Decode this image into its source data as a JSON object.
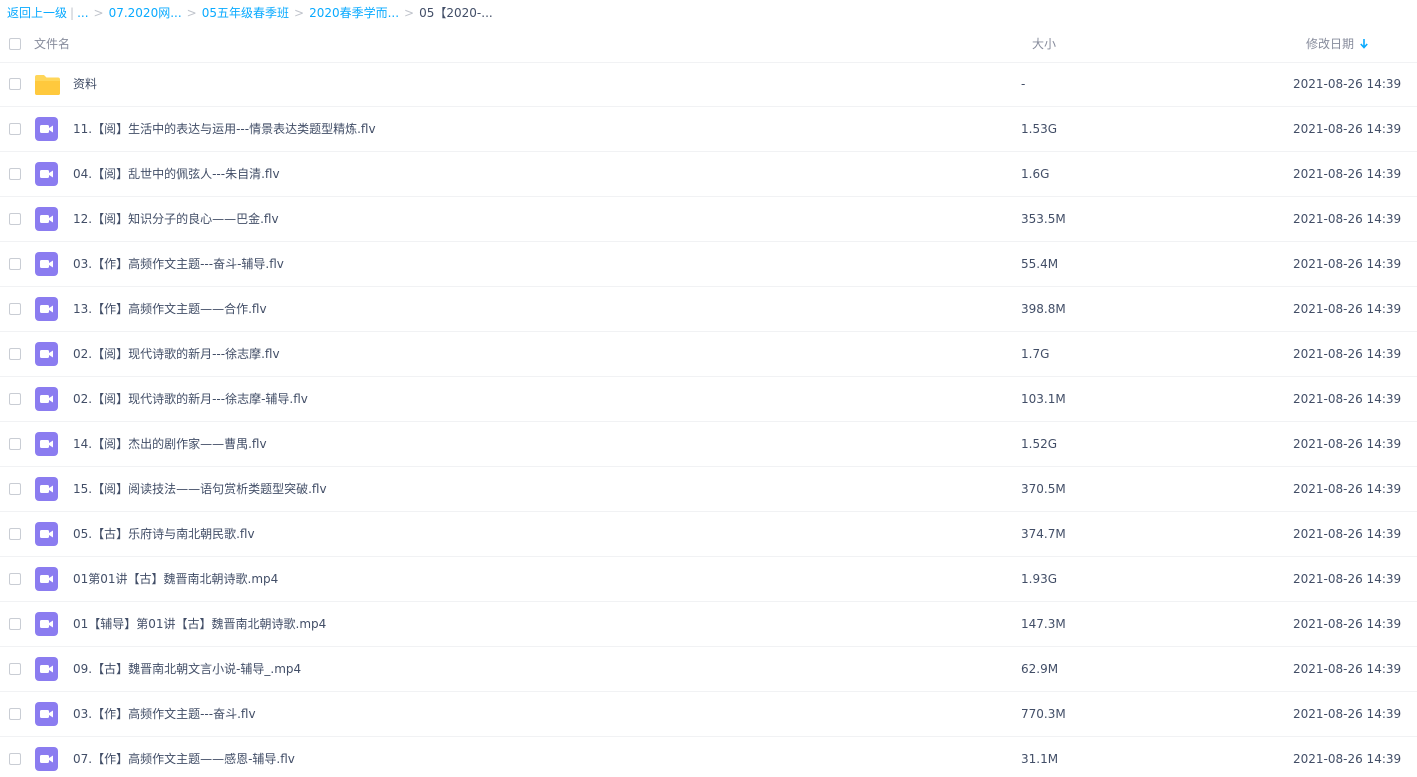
{
  "breadcrumb": {
    "back_label": "返回上一级",
    "ellipsis": "...",
    "items": [
      "07.2020网...",
      "05五年级春季班",
      "2020春季学而..."
    ],
    "current": "05【2020-..."
  },
  "header": {
    "name_label": "文件名",
    "size_label": "大小",
    "date_label": "修改日期",
    "sort_icon": "arrow-down-icon",
    "accent_color": "#09aaff"
  },
  "icons": {
    "folder": "folder-icon",
    "video": "video-file-icon",
    "folder_color": "#ffd659",
    "video_color": "#8b7cf0"
  },
  "files": [
    {
      "type": "folder",
      "name": "资料",
      "size": "-",
      "date": "2021-08-26 14:39"
    },
    {
      "type": "video",
      "name": "11.【阅】生活中的表达与运用---情景表达类题型精炼.flv",
      "size": "1.53G",
      "date": "2021-08-26 14:39"
    },
    {
      "type": "video",
      "name": "04.【阅】乱世中的佩弦人---朱自清.flv",
      "size": "1.6G",
      "date": "2021-08-26 14:39"
    },
    {
      "type": "video",
      "name": "12.【阅】知识分子的良心——巴金.flv",
      "size": "353.5M",
      "date": "2021-08-26 14:39"
    },
    {
      "type": "video",
      "name": "03.【作】高频作文主题---奋斗-辅导.flv",
      "size": "55.4M",
      "date": "2021-08-26 14:39"
    },
    {
      "type": "video",
      "name": "13.【作】高频作文主题——合作.flv",
      "size": "398.8M",
      "date": "2021-08-26 14:39"
    },
    {
      "type": "video",
      "name": "02.【阅】现代诗歌的新月---徐志摩.flv",
      "size": "1.7G",
      "date": "2021-08-26 14:39"
    },
    {
      "type": "video",
      "name": "02.【阅】现代诗歌的新月---徐志摩-辅导.flv",
      "size": "103.1M",
      "date": "2021-08-26 14:39"
    },
    {
      "type": "video",
      "name": "14.【阅】杰出的剧作家——曹禺.flv",
      "size": "1.52G",
      "date": "2021-08-26 14:39"
    },
    {
      "type": "video",
      "name": "15.【阅】阅读技法——语句赏析类题型突破.flv",
      "size": "370.5M",
      "date": "2021-08-26 14:39"
    },
    {
      "type": "video",
      "name": "05.【古】乐府诗与南北朝民歌.flv",
      "size": "374.7M",
      "date": "2021-08-26 14:39"
    },
    {
      "type": "video",
      "name": "01第01讲【古】魏晋南北朝诗歌.mp4",
      "size": "1.93G",
      "date": "2021-08-26 14:39"
    },
    {
      "type": "video",
      "name": "01【辅导】第01讲【古】魏晋南北朝诗歌.mp4",
      "size": "147.3M",
      "date": "2021-08-26 14:39"
    },
    {
      "type": "video",
      "name": "09.【古】魏晋南北朝文言小说-辅导_.mp4",
      "size": "62.9M",
      "date": "2021-08-26 14:39"
    },
    {
      "type": "video",
      "name": "03.【作】高频作文主题---奋斗.flv",
      "size": "770.3M",
      "date": "2021-08-26 14:39"
    },
    {
      "type": "video",
      "name": "07.【作】高频作文主题——感恩-辅导.flv",
      "size": "31.1M",
      "date": "2021-08-26 14:39"
    }
  ]
}
